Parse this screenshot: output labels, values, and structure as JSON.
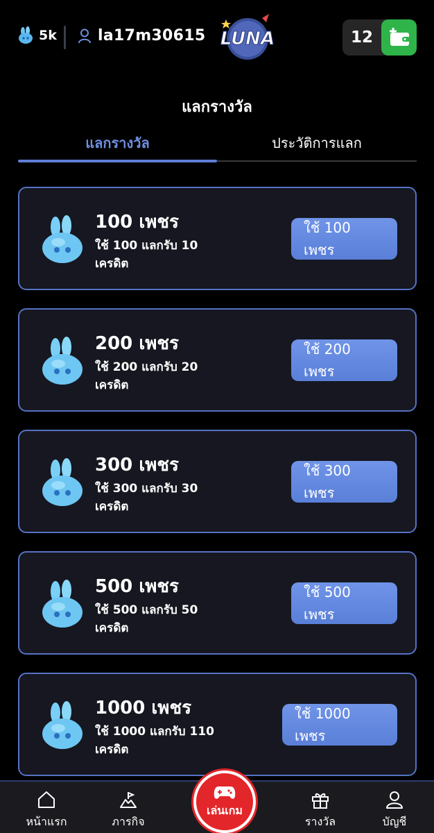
{
  "header": {
    "diamond_count": "5k",
    "username": "la17m30615",
    "logo_text": "LUNA",
    "wallet_count": "12"
  },
  "page_title": "แลกรางวัล",
  "tabs": [
    {
      "label": "แลกรางวัล",
      "active": true
    },
    {
      "label": "ประวัติการแลก",
      "active": false
    }
  ],
  "rewards": [
    {
      "title": "100 เพชร",
      "desc": "ใช้ 100 แลกรับ 10 เครดิต",
      "button": "ใช้ 100 เพชร"
    },
    {
      "title": "200 เพชร",
      "desc": "ใช้ 200 แลกรับ 20 เครดิต",
      "button": "ใช้ 200 เพชร"
    },
    {
      "title": "300 เพชร",
      "desc": "ใช้ 300 แลกรับ 30 เครดิต",
      "button": "ใช้ 300 เพชร"
    },
    {
      "title": "500 เพชร",
      "desc": "ใช้ 500 แลกรับ 50 เครดิต",
      "button": "ใช้ 500 เพชร"
    },
    {
      "title": "1000 เพชร",
      "desc": "ใช้ 1000 แลกรับ 110 เครดิต",
      "button": "ใช้ 1000 เพชร"
    }
  ],
  "bottom_nav": {
    "home": "หน้าแรก",
    "missions": "ภารกิจ",
    "play": "เล่นเกม",
    "rewards": "รางวัล",
    "account": "บัญชี"
  },
  "colors": {
    "accent": "#5e7fd6",
    "card_border": "#5572c4",
    "play_button": "#e3262a",
    "wallet_green": "#2fb44a"
  },
  "icons": [
    "diamond-icon",
    "user-icon",
    "wallet-add-icon",
    "gem-icon",
    "home-icon",
    "mission-icon",
    "gamepad-icon",
    "gift-icon",
    "account-icon"
  ]
}
